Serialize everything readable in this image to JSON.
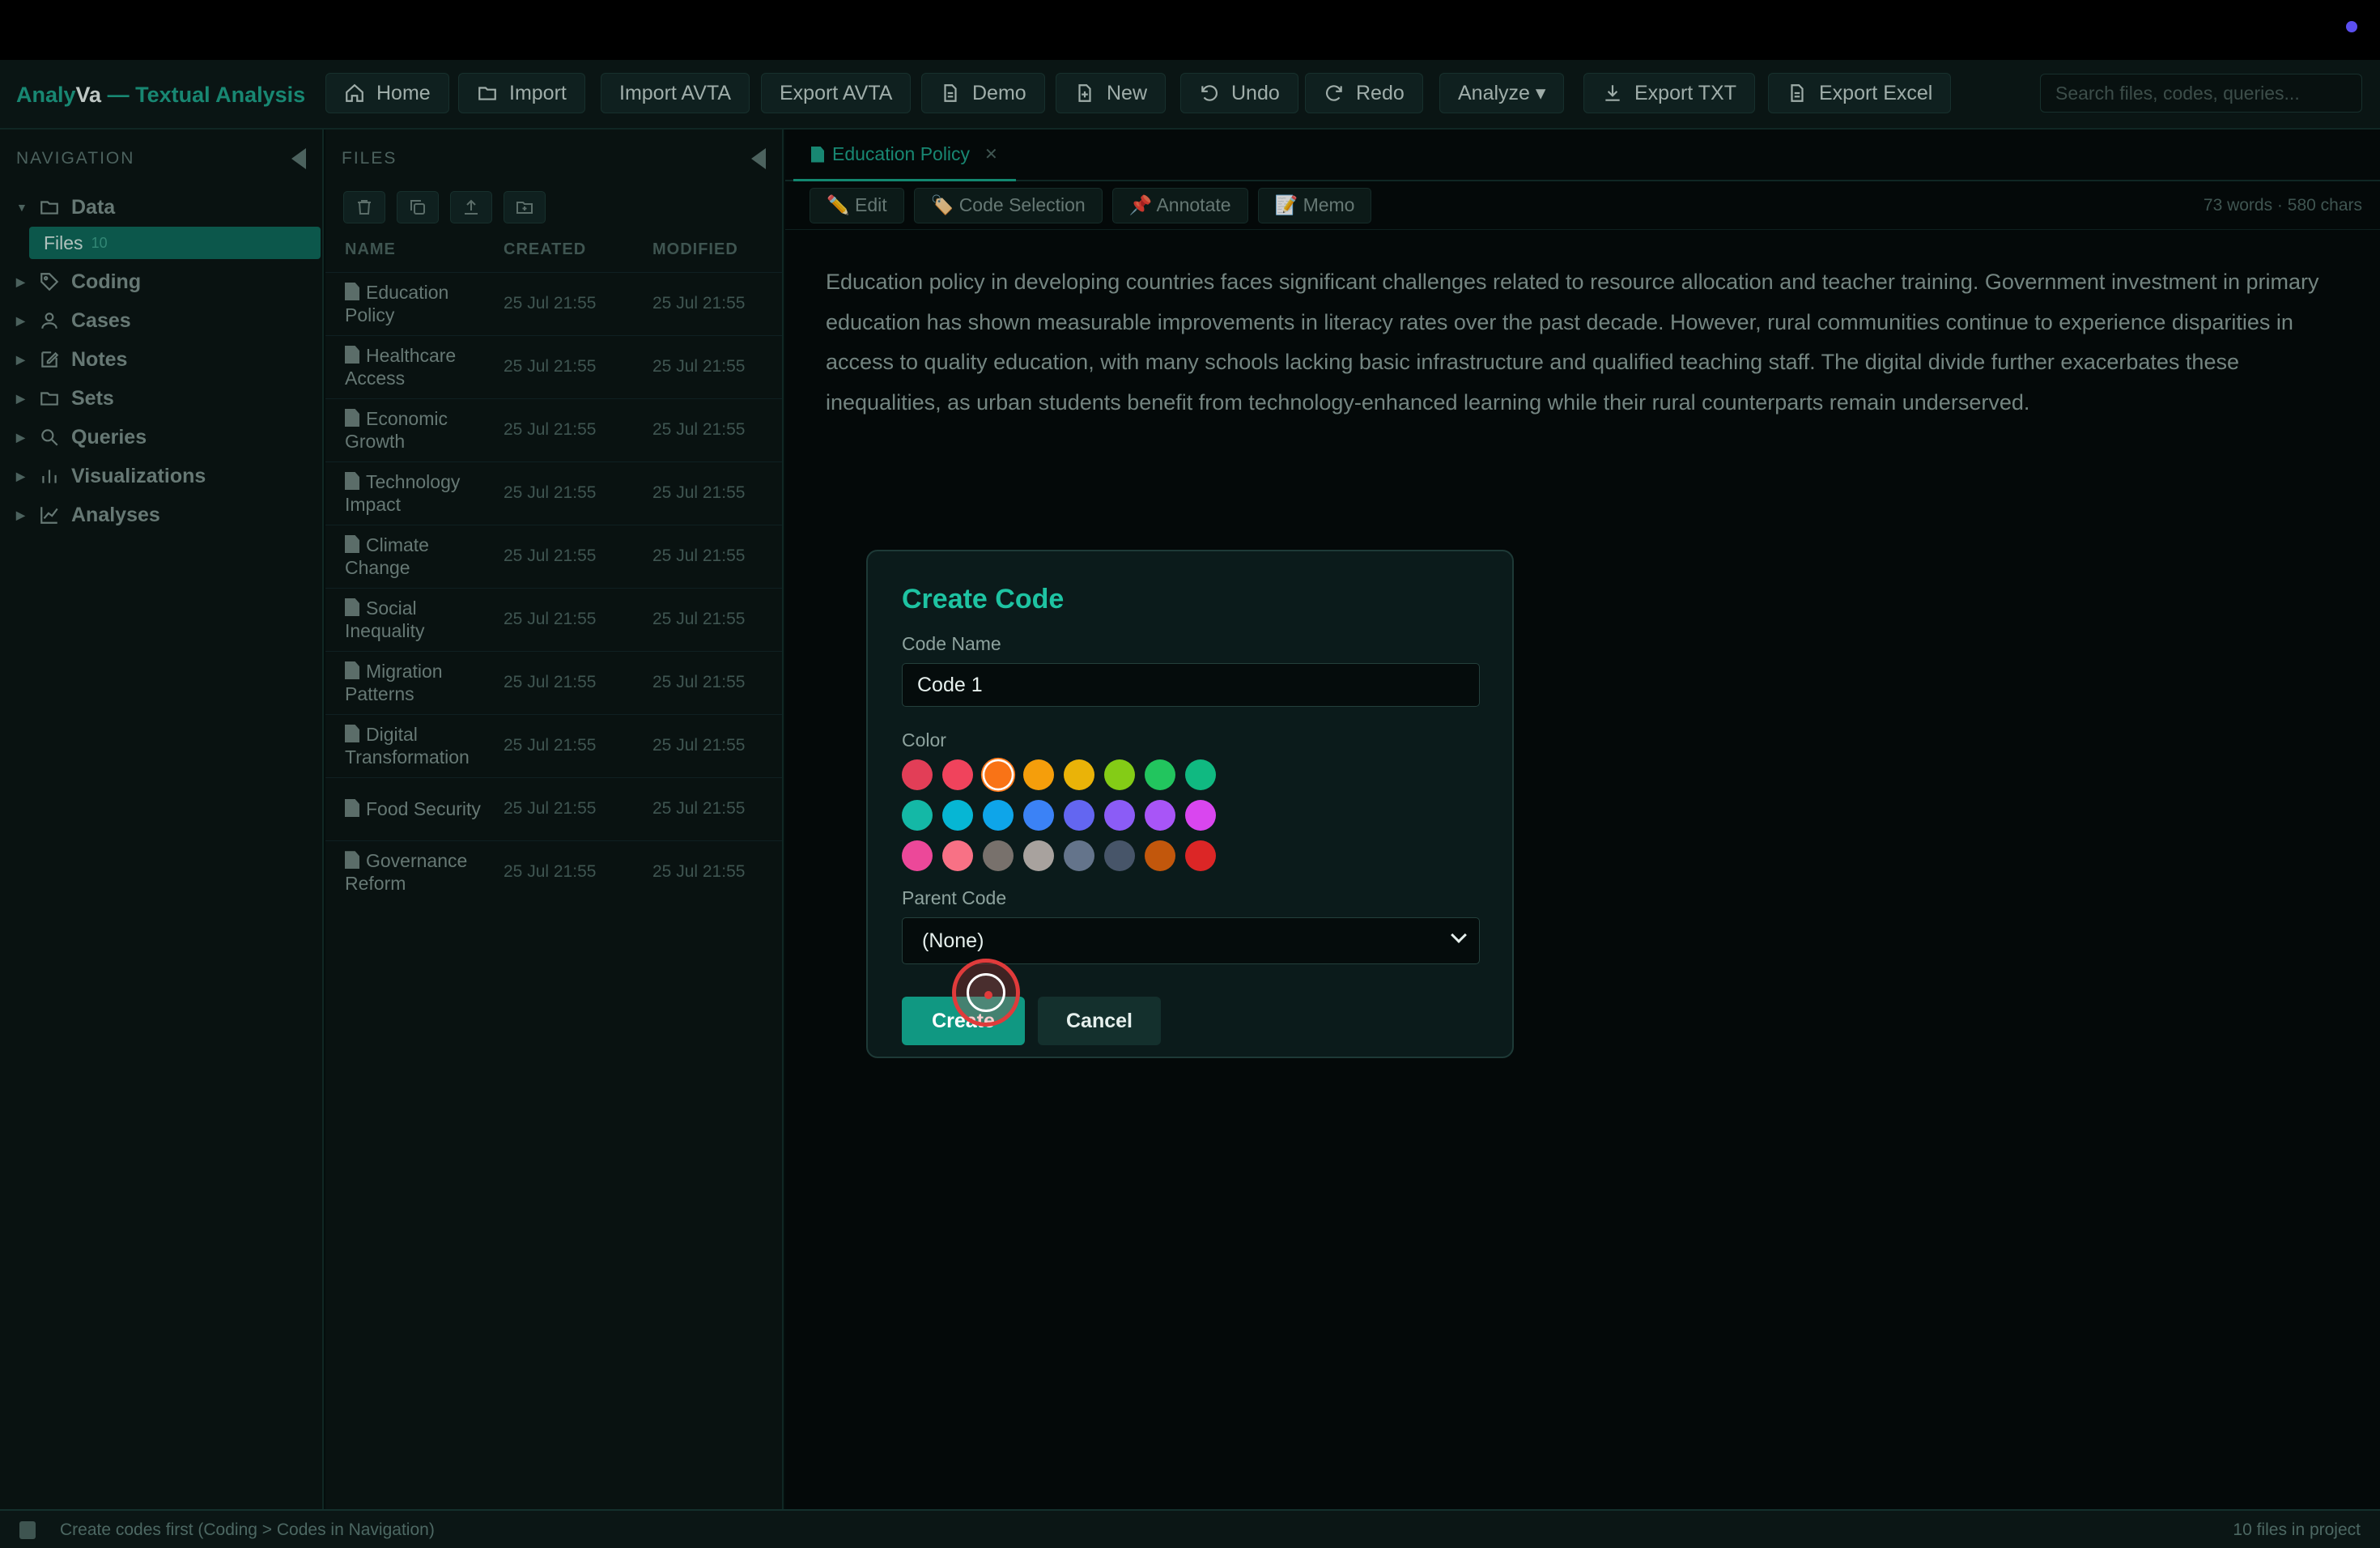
{
  "app": {
    "brand_prefix": "Analy",
    "brand_bold": "Va",
    "brand_suffix": " — Textual Analysis"
  },
  "toolbar": {
    "buttons": [
      {
        "label": "Home",
        "icon": "home-icon"
      },
      {
        "label": "Import",
        "icon": "folder-icon"
      },
      {
        "label": "Import AVTA"
      },
      {
        "label": "Export AVTA"
      },
      {
        "label": "Demo",
        "icon": "document-icon"
      },
      {
        "label": "New",
        "icon": "new-file-icon"
      },
      {
        "label": "Undo",
        "icon": "undo-icon"
      },
      {
        "label": "Redo",
        "icon": "redo-icon"
      },
      {
        "label": "Analyze ▾"
      },
      {
        "label": "Export TXT",
        "icon": "download-icon"
      },
      {
        "label": "Export Excel",
        "icon": "document-icon"
      }
    ],
    "search_placeholder": "Search files, codes, queries..."
  },
  "navigation": {
    "title": "NAVIGATION",
    "items": [
      {
        "label": "Data",
        "icon": "folder-icon",
        "expanded": true
      },
      {
        "label": "Coding",
        "icon": "tag-icon"
      },
      {
        "label": "Cases",
        "icon": "user-icon"
      },
      {
        "label": "Notes",
        "icon": "edit-icon"
      },
      {
        "label": "Sets",
        "icon": "folder-icon"
      },
      {
        "label": "Queries",
        "icon": "search-icon"
      },
      {
        "label": "Visualizations",
        "icon": "bar-chart-icon"
      },
      {
        "label": "Analyses",
        "icon": "line-chart-icon"
      }
    ],
    "sub_item": {
      "label": "Files",
      "count": "10"
    }
  },
  "files": {
    "title": "FILES",
    "columns": [
      "NAME",
      "CREATED",
      "MODIFIED"
    ],
    "rows": [
      {
        "name": "Education Policy",
        "created": "25 Jul 21:55",
        "modified": "25 Jul 21:55"
      },
      {
        "name": "Healthcare Access",
        "created": "25 Jul 21:55",
        "modified": "25 Jul 21:55"
      },
      {
        "name": "Economic Growth",
        "created": "25 Jul 21:55",
        "modified": "25 Jul 21:55"
      },
      {
        "name": "Technology Impact",
        "created": "25 Jul 21:55",
        "modified": "25 Jul 21:55"
      },
      {
        "name": "Climate Change",
        "created": "25 Jul 21:55",
        "modified": "25 Jul 21:55"
      },
      {
        "name": "Social Inequality",
        "created": "25 Jul 21:55",
        "modified": "25 Jul 21:55"
      },
      {
        "name": "Migration Patterns",
        "created": "25 Jul 21:55",
        "modified": "25 Jul 21:55"
      },
      {
        "name": "Digital Transformation",
        "created": "25 Jul 21:55",
        "modified": "25 Jul 21:55"
      },
      {
        "name": "Food Security",
        "created": "25 Jul 21:55",
        "modified": "25 Jul 21:55"
      },
      {
        "name": "Governance Reform",
        "created": "25 Jul 21:55",
        "modified": "25 Jul 21:55"
      }
    ]
  },
  "editor": {
    "tab_label": "Education Policy",
    "tools": [
      "✏️ Edit",
      "🏷️ Code Selection",
      "📌 Annotate",
      "📝 Memo"
    ],
    "word_count": "73 words · 580 chars",
    "text": "Education policy in developing countries faces significant challenges related to resource allocation and teacher training. Government investment in primary education has shown measurable improvements in literacy rates over the past decade. However, rural communities continue to experience disparities in access to quality education, with many schools lacking basic infrastructure and qualified teaching staff. The digital divide further exacerbates these inequalities, as urban students benefit from technology-enhanced learning while their rural counterparts remain underserved."
  },
  "modal": {
    "title": "Create Code",
    "name_label": "Code Name",
    "name_value": "Code 1",
    "color_label": "Color",
    "colors": [
      "#e23e57",
      "#f0435c",
      "#f97316",
      "#f59e0b",
      "#eab308",
      "#84cc16",
      "#22c55e",
      "#10b981",
      "#14b8a6",
      "#06b6d4",
      "#0ea5e9",
      "#3b82f6",
      "#6366f1",
      "#8b5cf6",
      "#a855f7",
      "#d946ef",
      "#ec4899",
      "#f87185",
      "#78716c",
      "#a8a29e",
      "#64748b",
      "#475569",
      "#c2570c",
      "#dc2626"
    ],
    "selected_color": "#f97316",
    "parent_label": "Parent Code",
    "parent_value": "(None)",
    "create_label": "Create",
    "cancel_label": "Cancel"
  },
  "status": {
    "message": "Create codes first (Coding > Codes in Navigation)",
    "right": "10 files in project"
  }
}
